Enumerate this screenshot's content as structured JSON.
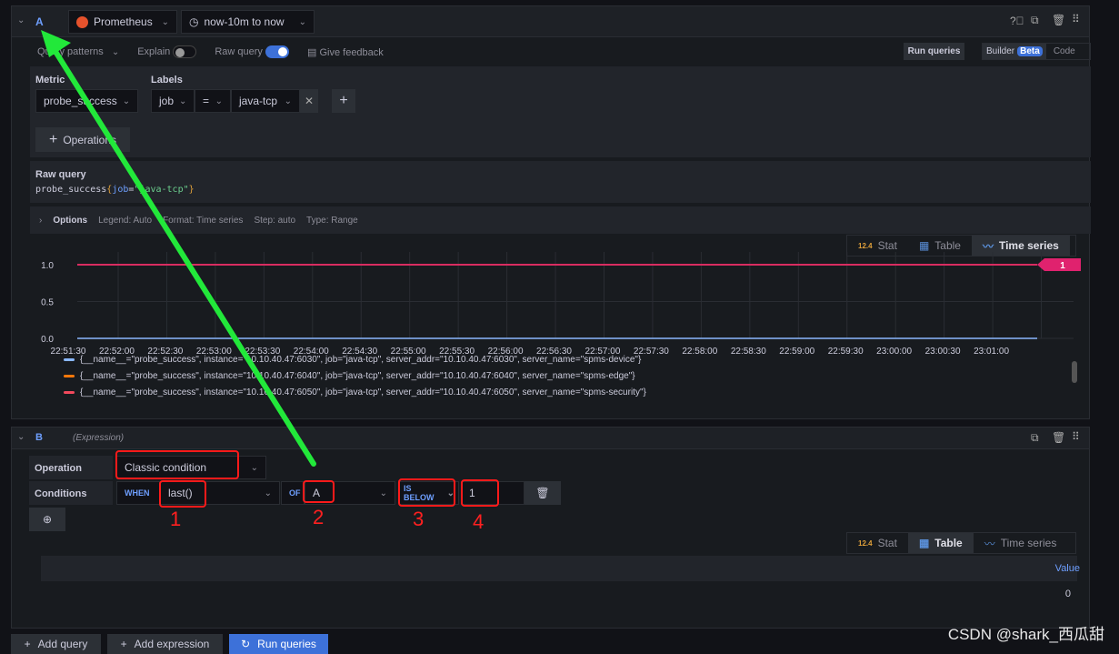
{
  "query_a": {
    "ref_id": "A",
    "datasource": "Prometheus",
    "time_range": "now-10m to now",
    "query_patterns": "Query patterns",
    "explain": "Explain",
    "raw_query_toggle": "Raw query",
    "give_feedback": "Give feedback",
    "run_queries": "Run queries",
    "builder": "Builder",
    "beta": "Beta",
    "code": "Code",
    "metric_label": "Metric",
    "metric_value": "probe_success",
    "labels_label": "Labels",
    "label_key": "job",
    "label_op": "=",
    "label_value": "java-tcp",
    "operations": "Operations",
    "raw_query_label": "Raw query",
    "raw_query": {
      "metric": "probe_success",
      "open": "{",
      "key": "job",
      "eq": "=",
      "val": "\"java-tcp\"",
      "close": "}"
    },
    "options": {
      "title": "Options",
      "legend": "Legend: Auto",
      "format": "Format: Time series",
      "step": "Step: auto",
      "type": "Type: Range"
    },
    "viz_tabs": [
      "Stat",
      "Table",
      "Time series"
    ],
    "active_viz": "Time series",
    "threshold_badge": "1"
  },
  "chart_data": {
    "type": "line",
    "y_ticks": [
      "1.0",
      "0.5",
      "0.0"
    ],
    "ylim": [
      0,
      1
    ],
    "x_ticks": [
      "22:51:30",
      "22:52:00",
      "22:52:30",
      "22:53:00",
      "22:53:30",
      "22:54:00",
      "22:54:30",
      "22:55:00",
      "22:55:30",
      "22:56:00",
      "22:56:30",
      "22:57:00",
      "22:57:30",
      "22:58:00",
      "22:58:30",
      "22:59:00",
      "22:59:30",
      "23:00:00",
      "23:00:30",
      "23:01:00"
    ],
    "grid": true,
    "series": [
      {
        "name": "{__name__=\"probe_success\", instance=\"10.10.40.47:6030\", job=\"java-tcp\", server_addr=\"10.10.40.47:6030\", server_name=\"spms-device\"}",
        "color": "#8ab8ff",
        "value": 0
      },
      {
        "name": "{__name__=\"probe_success\", instance=\"10.10.40.47:6040\", job=\"java-tcp\", server_addr=\"10.10.40.47:6040\", server_name=\"spms-edge\"}",
        "color": "#ff780a",
        "value": 1
      },
      {
        "name": "{__name__=\"probe_success\", instance=\"10.10.40.47:6050\", job=\"java-tcp\", server_addr=\"10.10.40.47:6050\", server_name=\"spms-security\"}",
        "color": "#f2495c",
        "value": 1
      }
    ]
  },
  "query_b": {
    "ref_id": "B",
    "type": "(Expression)",
    "operation_label": "Operation",
    "operation_value": "Classic condition",
    "conditions_label": "Conditions",
    "when": "WHEN",
    "reducer": "last()",
    "of": "OF",
    "query": "A",
    "evaluator": "IS BELOW",
    "threshold": "1",
    "viz_tabs": [
      "Stat",
      "Table",
      "Time series"
    ],
    "active_viz": "Table",
    "table_header": "Value",
    "table_value": "0"
  },
  "footer": {
    "add_query": "Add query",
    "add_expression": "Add expression",
    "run_queries": "Run queries"
  },
  "annotations": [
    "1",
    "2",
    "3",
    "4"
  ],
  "watermark": "CSDN @shark_西瓜甜",
  "colors": {
    "accent": "#3d71d9",
    "annotation_arrow": "#22e83a",
    "annotation_box": "#ff1a1a",
    "threshold": "#e0226e"
  }
}
